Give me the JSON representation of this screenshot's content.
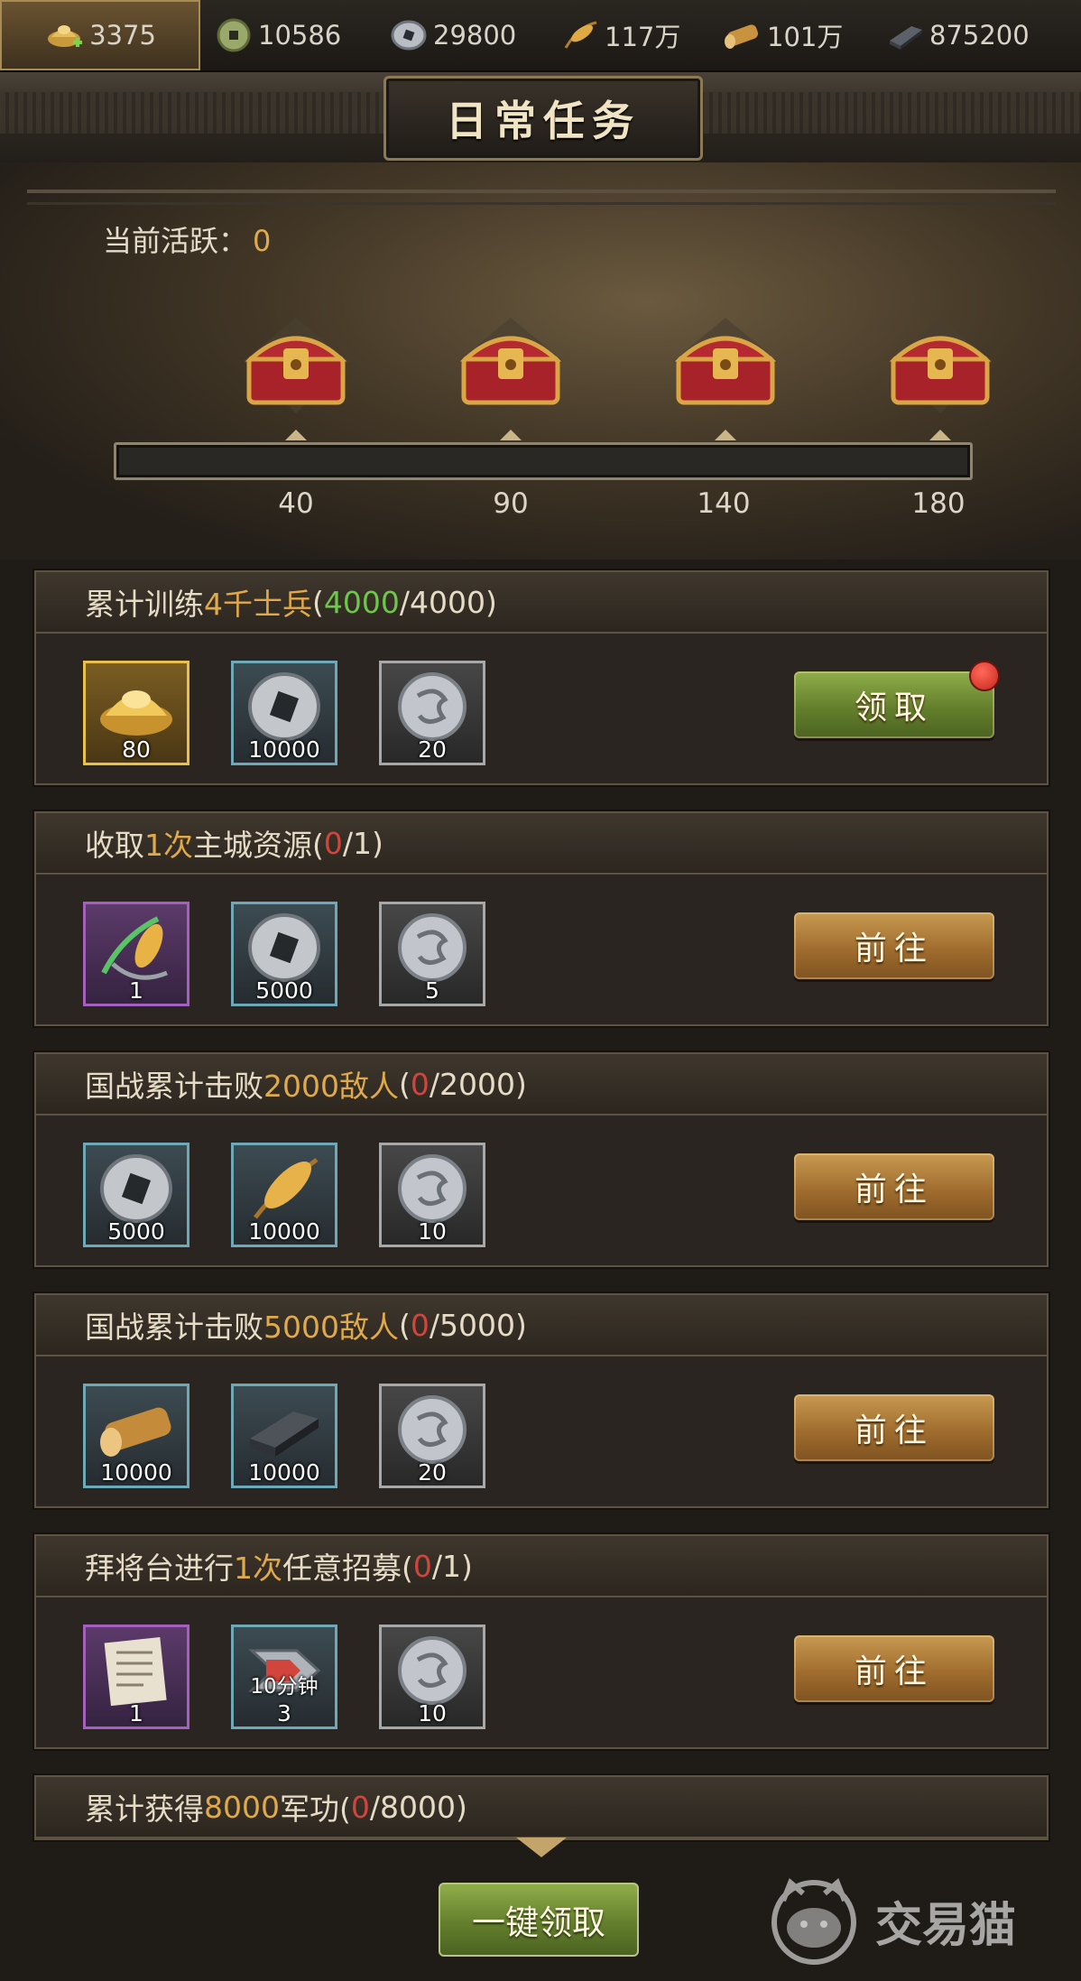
{
  "resources": [
    {
      "icon": "gold-ingot-add-icon",
      "value": "3375"
    },
    {
      "icon": "jade-coin-icon",
      "value": "10586"
    },
    {
      "icon": "silver-coin-icon",
      "value": "29800"
    },
    {
      "icon": "grain-icon",
      "value": "117万"
    },
    {
      "icon": "wood-log-icon",
      "value": "101万"
    },
    {
      "icon": "iron-ingot-icon",
      "value": "875200"
    }
  ],
  "title": "日常任务",
  "activity": {
    "label": "当前活跃：",
    "value": "0"
  },
  "chests": [
    {
      "threshold": "40"
    },
    {
      "threshold": "90"
    },
    {
      "threshold": "140"
    },
    {
      "threshold": "180"
    }
  ],
  "progress": {
    "value": 0
  },
  "tasks": [
    {
      "title_parts": [
        "累计训练",
        "4千士兵",
        "(",
        "4000",
        "/4000)"
      ],
      "rewards": [
        {
          "icon": "gold-ingot-icon",
          "count": "80",
          "frame": "gold"
        },
        {
          "icon": "silver-coin-icon",
          "count": "10000",
          "frame": "blue"
        },
        {
          "icon": "dragon-coin-icon",
          "count": "20",
          "frame": "gray"
        }
      ],
      "button": "领取",
      "button_type": "claim"
    },
    {
      "title_parts": [
        "收取",
        "1次",
        "主城资源(",
        "0",
        "/1)"
      ],
      "rewards": [
        {
          "icon": "grain-sickle-icon",
          "count": "1",
          "frame": "purple"
        },
        {
          "icon": "silver-coin-icon",
          "count": "5000",
          "frame": "blue"
        },
        {
          "icon": "dragon-coin-icon",
          "count": "5",
          "frame": "gray"
        }
      ],
      "button": "前往",
      "button_type": "go"
    },
    {
      "title_parts": [
        "国战累计击败",
        "2000敌人",
        "(",
        "0",
        "/2000)"
      ],
      "rewards": [
        {
          "icon": "silver-coin-icon",
          "count": "5000",
          "frame": "blue"
        },
        {
          "icon": "grain-icon",
          "count": "10000",
          "frame": "blue"
        },
        {
          "icon": "dragon-coin-icon",
          "count": "10",
          "frame": "gray"
        }
      ],
      "button": "前往",
      "button_type": "go"
    },
    {
      "title_parts": [
        "国战累计击败",
        "5000敌人",
        "(",
        "0",
        "/5000)"
      ],
      "rewards": [
        {
          "icon": "wood-log-icon",
          "count": "10000",
          "frame": "blue"
        },
        {
          "icon": "iron-ingot-icon",
          "count": "10000",
          "frame": "blue"
        },
        {
          "icon": "dragon-coin-icon",
          "count": "20",
          "frame": "gray"
        }
      ],
      "button": "前往",
      "button_type": "go"
    },
    {
      "title_parts": [
        "拜将台进行",
        "1次",
        "任意招募(",
        "0",
        "/1)"
      ],
      "rewards": [
        {
          "icon": "scroll-icon",
          "count": "1",
          "frame": "purple"
        },
        {
          "icon": "speedup-arrow-icon",
          "count": "3",
          "tag": "10分钟",
          "frame": "blue"
        },
        {
          "icon": "dragon-coin-icon",
          "count": "10",
          "frame": "gray"
        }
      ],
      "button": "前往",
      "button_type": "go"
    },
    {
      "title_parts": [
        "累计获得",
        "8000",
        "军功(",
        "0",
        "/8000)"
      ]
    }
  ],
  "claim_all": "一键领取",
  "watermark": "交易猫"
}
